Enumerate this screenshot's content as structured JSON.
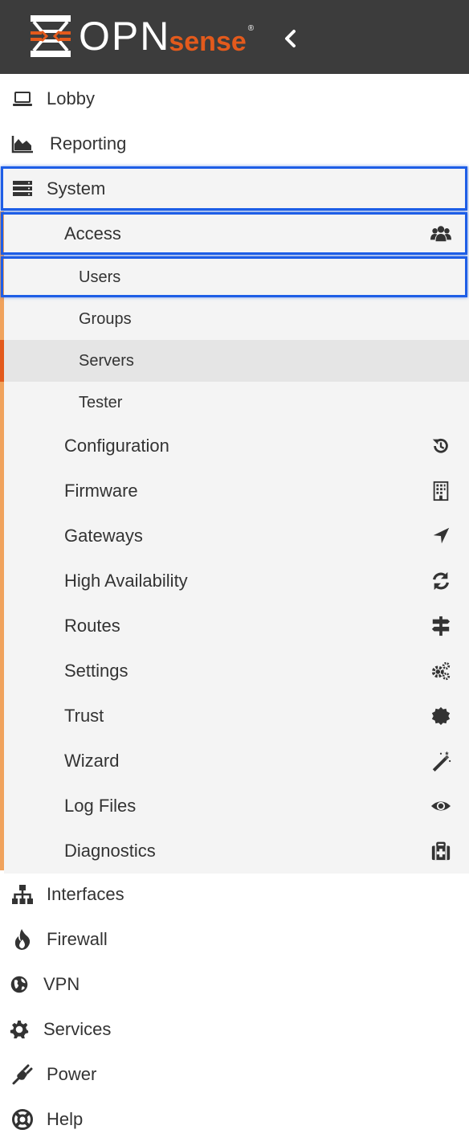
{
  "logo": {
    "text": "OPN",
    "sense": "sense",
    "reg": "®"
  },
  "menu": {
    "lobby": "Lobby",
    "reporting": "Reporting",
    "system": "System",
    "access": "Access",
    "users": "Users",
    "groups": "Groups",
    "servers": "Servers",
    "tester": "Tester",
    "configuration": "Configuration",
    "firmware": "Firmware",
    "gateways": "Gateways",
    "high_availability": "High Availability",
    "routes": "Routes",
    "settings": "Settings",
    "trust": "Trust",
    "wizard": "Wizard",
    "log_files": "Log Files",
    "diagnostics": "Diagnostics",
    "interfaces": "Interfaces",
    "firewall": "Firewall",
    "vpn": "VPN",
    "services": "Services",
    "power": "Power",
    "help": "Help"
  },
  "colors": {
    "header": "#3c3c3c",
    "brand": "#e35a1c",
    "accent_bar": "#f0a25c",
    "highlight": "#1e5ee6",
    "submenu_bg": "#f4f4f4"
  }
}
